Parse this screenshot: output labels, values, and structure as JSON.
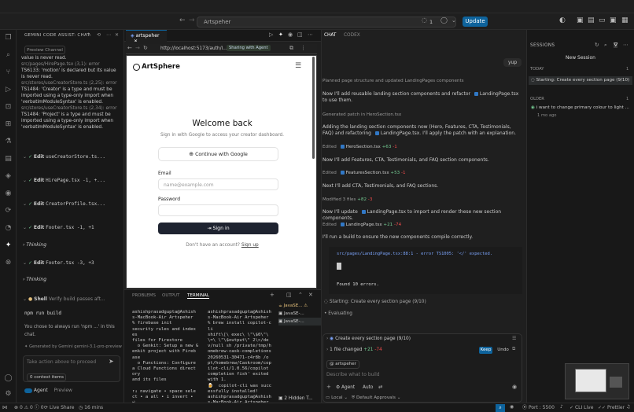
{
  "titlebar": {
    "search_text": "Artspeher",
    "badge_count": "1",
    "update_label": "Update"
  },
  "gemini": {
    "title": "GEMINI CODE ASSIST: CHAT",
    "preview_channel": "Preview Channel",
    "error_log": [
      "value is never read.",
      "src/pages/HirePage.tsx (3,1): error",
      "TS6133: 'motion' is declared but its value",
      "is never read.",
      "src/stores/useCreatorStore.ts (2,25): error",
      "TS1484: 'Creator' is a type and must be",
      "imported using a type-only import when",
      "'verbatimModuleSyntax' is enabled.",
      "src/stores/useCreatorStore.ts (2,34): error",
      "TS1484: 'Project' is a type and must be",
      "imported using a type-only import when",
      "'verbatimModuleSyntax' is enabled."
    ],
    "steps": [
      {
        "action": "Edit",
        "file": "useCreatorStore.ts..."
      },
      {
        "action": "Edit",
        "file": "HirePage.tsx -1, +..."
      },
      {
        "action": "Edit",
        "file": "CreatorProfile.tsx..."
      },
      {
        "action": "Edit",
        "file": "Footer.tsx -1, +1"
      },
      {
        "action": "Edit",
        "file": "Footer.tsx -3, +3"
      }
    ],
    "thinking_label": "Thinking",
    "shell_label": "Shell",
    "shell_desc": "Verify build passes aft...",
    "shell_cmd": "npm run build",
    "shell_note": "You chose to always run 'npm ...' in this chat.",
    "generated_by": "Generated by Gemini gemini-3.1-pro-preview",
    "input_placeholder": "Take action above to proceed",
    "context_items": "0 context items",
    "agent_label": "Agent",
    "preview_label": "Preview"
  },
  "editor": {
    "tab_label": "artspeher",
    "url": "http://localhost:5173/auth/l...",
    "sharing_label": "Sharing with Agent"
  },
  "app_page": {
    "logo": "ArtSphere",
    "heading": "Welcome back",
    "subheading": "Sign in with Google to access your creator dashboard.",
    "google_button": "Continue with Google",
    "email_label": "Email",
    "email_placeholder": "name@example.com",
    "password_label": "Password",
    "signin_button": "Sign in",
    "no_account": "Don't have an account?",
    "signup_link": "Sign up"
  },
  "terminal": {
    "tabs": [
      "PROBLEMS",
      "OUTPUT",
      "TERMINAL"
    ],
    "left_output": "ashishprasadgupta@Ashish\ns-MacBook-Air Artspeher\n% firebase init\nsecurity rules and index\nes\nfiles for Firestore\n  o Genkit: Setup a new G\nenkit project with Fireb\nase\n  o Functions: Configure\na Cloud Functions direct\nory\nand its files\n\n↑↓ navigate • space sele\nct • a all • i invert •\n⏎\nsubmit",
    "right_output": "ashishprasadgupta@Ashish\ns-MacBook-Air Artspeher\n% brew install copilot-c\nli\nshift\\[\\ exec\\ \\\"\\$0\\\"\\\n\\=\\ \\\"\\$output\\\" 2\\>/de\nv/null sh /private/tmp/h\nomebrew-cask-completions\n20260531-30471-c4r8b /o\npt/homebrew/Caskroom/cop\nilot-cli/1.0.56/copilot\ncompletion fish' exited\nwith 1.\n🍺  copilot-cli was succ\nessfully installed!\nashishprasadgupta@Ashish\ns-MacBook-Air Artspeher\n% ▯",
    "sessions": [
      "JavaSE...",
      "JavaSE-...",
      "JavaSE-..."
    ],
    "hidden_label": "2 Hidden T..."
  },
  "chat": {
    "tabs": [
      "CHAT",
      "CODEX"
    ],
    "user_msg": "yup",
    "messages": [
      {
        "kind": "note",
        "text": "Planned page structure and updated LandingPages components"
      },
      {
        "kind": "text",
        "text": "Now I'll add reusable landing section components and refactor",
        "file": "LandingPage.tsx",
        "tail": "to use them."
      },
      {
        "kind": "note",
        "text": "Generated patch in HeroSection.tsx"
      },
      {
        "kind": "text",
        "text": "Adding the landing section components now (Hero, Features, CTA, Testimonials, FAQ) and refactoring",
        "file": "LandingPage.tsx",
        "tail": ". I'll apply the patch with an explanation."
      },
      {
        "kind": "edit",
        "label": "Edited",
        "file": "HeroSection.tsx",
        "add": "+63",
        "del": "-1"
      },
      {
        "kind": "text",
        "text": "Now I'll add Features, CTA, Testimonials, and FAQ section components."
      },
      {
        "kind": "edit",
        "label": "Edited",
        "file": "FeaturesSection.tsx",
        "add": "+53",
        "del": "-1"
      },
      {
        "kind": "text",
        "text": "Next I'll add CTA, Testimonials, and FAQ sections."
      },
      {
        "kind": "edit",
        "label": "Modified 3 files",
        "file": "",
        "add": "+82",
        "del": "-3"
      },
      {
        "kind": "text",
        "text": "Now I'll update",
        "file": "LandingPage.tsx",
        "tail": "to import and render these new section components."
      },
      {
        "kind": "edit",
        "label": "Edited",
        "file": "LandingPage.tsx",
        "add": "+21",
        "del": "-74"
      },
      {
        "kind": "text",
        "text": "I'll run a build to ensure the new components compile correctly."
      }
    ],
    "build_error": "src/pages/LandingPage.tsx:88:1 - error TS1005: '</' expected.",
    "build_found": "Found 10 errors.",
    "starting_label": "Starting: Create every section page (9/10)",
    "evaluating_label": "Evaluating",
    "todo_label": "Create every section page (9/10)",
    "changed_label": "1 file changed",
    "changed_add": "+21",
    "changed_del": "-74",
    "keep_label": "Keep",
    "undo_label": "Undo",
    "context_chip": "artspeher",
    "input_placeholder": "Describe what to build",
    "agent_label": "Agent",
    "auto_label": "Auto",
    "local_label": "Local",
    "approvals_label": "Default Approvals"
  },
  "sessions": {
    "title": "SESSIONS",
    "new_session": "New Session",
    "today_label": "TODAY",
    "today_items": [
      "Starting: Create every section page (9/10)"
    ],
    "older_label": "OLDER",
    "older_items": [
      {
        "title": "i want to change primary colour to light ...",
        "time": "1 mo ago"
      }
    ]
  },
  "statusbar": {
    "errors": "0",
    "warnings": "0",
    "info": "0",
    "live_share": "Live Share",
    "time": "16 mins",
    "port": "Port : 5500",
    "cli": "CLI Live",
    "prettier": "Prettier"
  }
}
